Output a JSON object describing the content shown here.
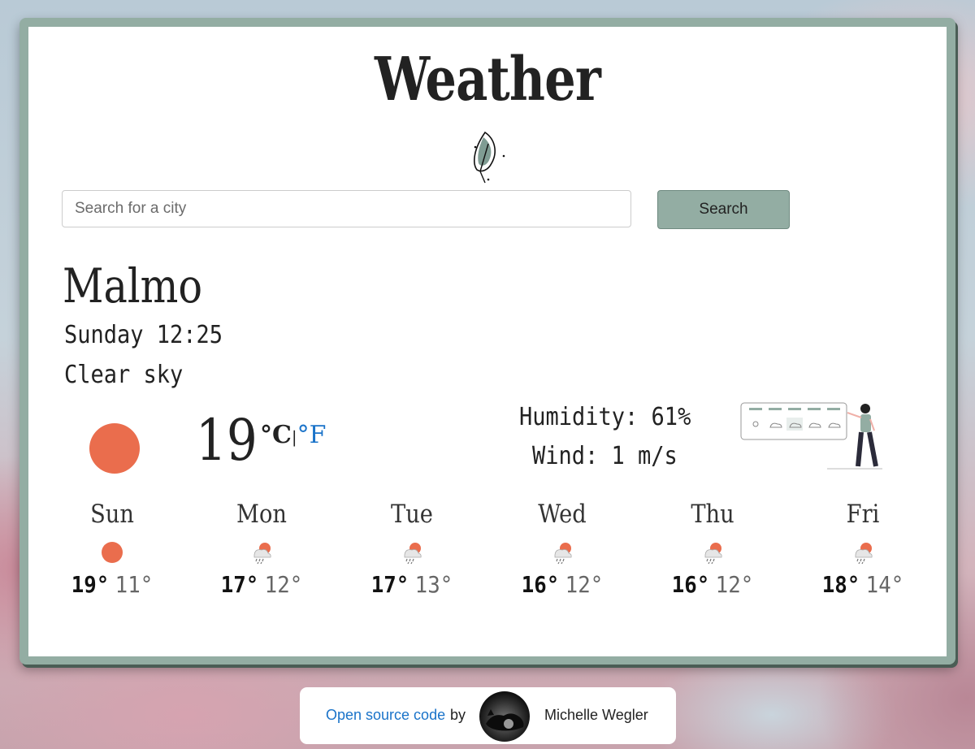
{
  "header": {
    "title": "Weather"
  },
  "search": {
    "placeholder": "Search for a city",
    "button_label": "Search"
  },
  "current": {
    "city": "Malmo",
    "datetime": "Sunday 12:25",
    "description": "Clear sky",
    "temperature": "19",
    "unit_celsius": "°C",
    "unit_separator": "|",
    "unit_fahrenheit": "°F",
    "humidity": "Humidity: 61%",
    "wind": "Wind: 1 m/s",
    "icon": "sun-icon"
  },
  "forecast": [
    {
      "day": "Sun",
      "max": "19°",
      "min": "11°",
      "icon": "sun-icon"
    },
    {
      "day": "Mon",
      "max": "17°",
      "min": "12°",
      "icon": "rain-cloud-sun-icon"
    },
    {
      "day": "Tue",
      "max": "17°",
      "min": "13°",
      "icon": "rain-cloud-sun-icon"
    },
    {
      "day": "Wed",
      "max": "16°",
      "min": "12°",
      "icon": "rain-cloud-sun-icon"
    },
    {
      "day": "Thu",
      "max": "16°",
      "min": "12°",
      "icon": "rain-cloud-sun-icon"
    },
    {
      "day": "Fri",
      "max": "18°",
      "min": "14°",
      "icon": "rain-cloud-sun-icon"
    }
  ],
  "footer": {
    "source_link": "Open source code",
    "by": "by",
    "author": "Michelle Wegler"
  },
  "colors": {
    "accent": "#93ada3",
    "accent_dark": "#4a5d55",
    "sun": "#ea6d4d",
    "link": "#1a73c9"
  }
}
